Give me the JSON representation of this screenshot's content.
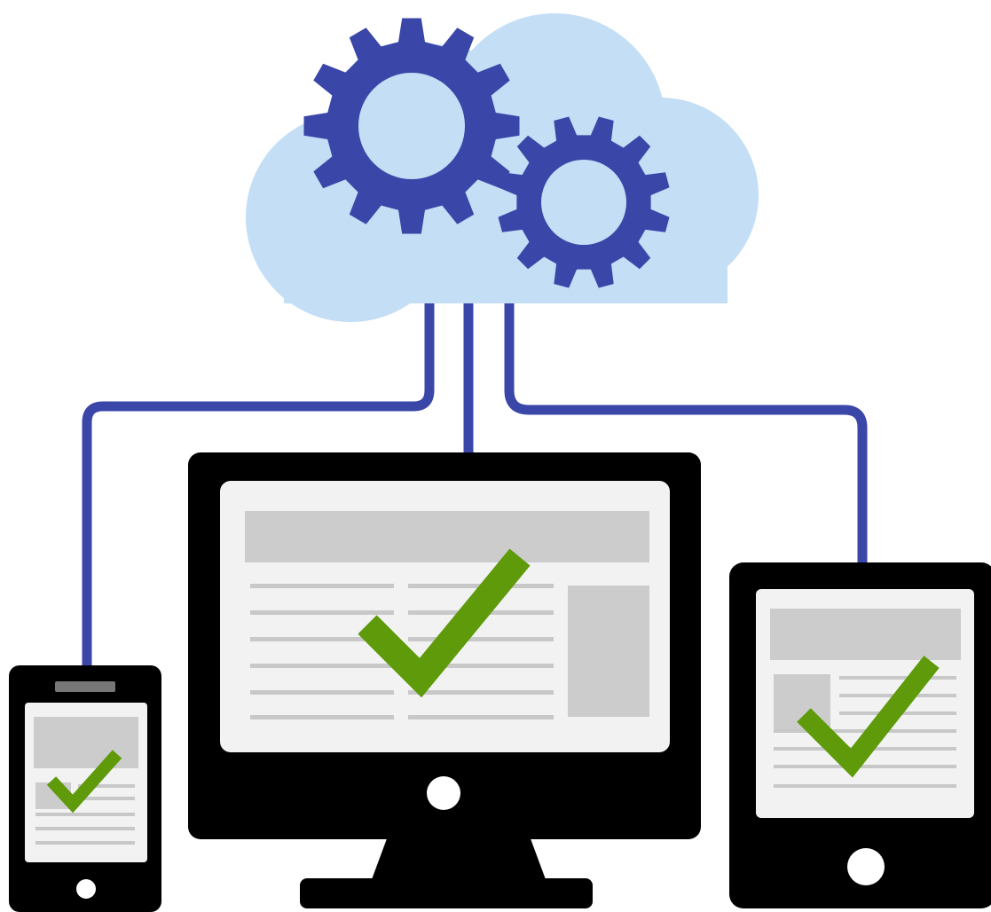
{
  "illustration": {
    "subject": "cloud-service-to-multiple-devices",
    "elements": {
      "cloud": {
        "icon": "cloud-icon",
        "contains": [
          "large-gear-icon",
          "small-gear-icon"
        ]
      },
      "connectors": [
        "connector-to-phone",
        "connector-to-desktop",
        "connector-to-tablet"
      ],
      "devices": [
        {
          "id": "phone",
          "icon": "smartphone-icon",
          "status_icon": "check-mark-icon"
        },
        {
          "id": "desktop",
          "icon": "desktop-monitor-icon",
          "status_icon": "check-mark-icon"
        },
        {
          "id": "tablet",
          "icon": "tablet-icon",
          "status_icon": "check-mark-icon"
        }
      ]
    }
  },
  "colors": {
    "background": "#ffffff",
    "cloud": "#c3def5",
    "gear": "#3a46a8",
    "connector": "#3a46a8",
    "device_body": "#000000",
    "screen": "#f2f2f2",
    "content_block": "#cccccc",
    "content_line": "#c8c8c8",
    "check": "#5e9a0a",
    "home_button": "#ffffff",
    "speaker": "#777777"
  }
}
